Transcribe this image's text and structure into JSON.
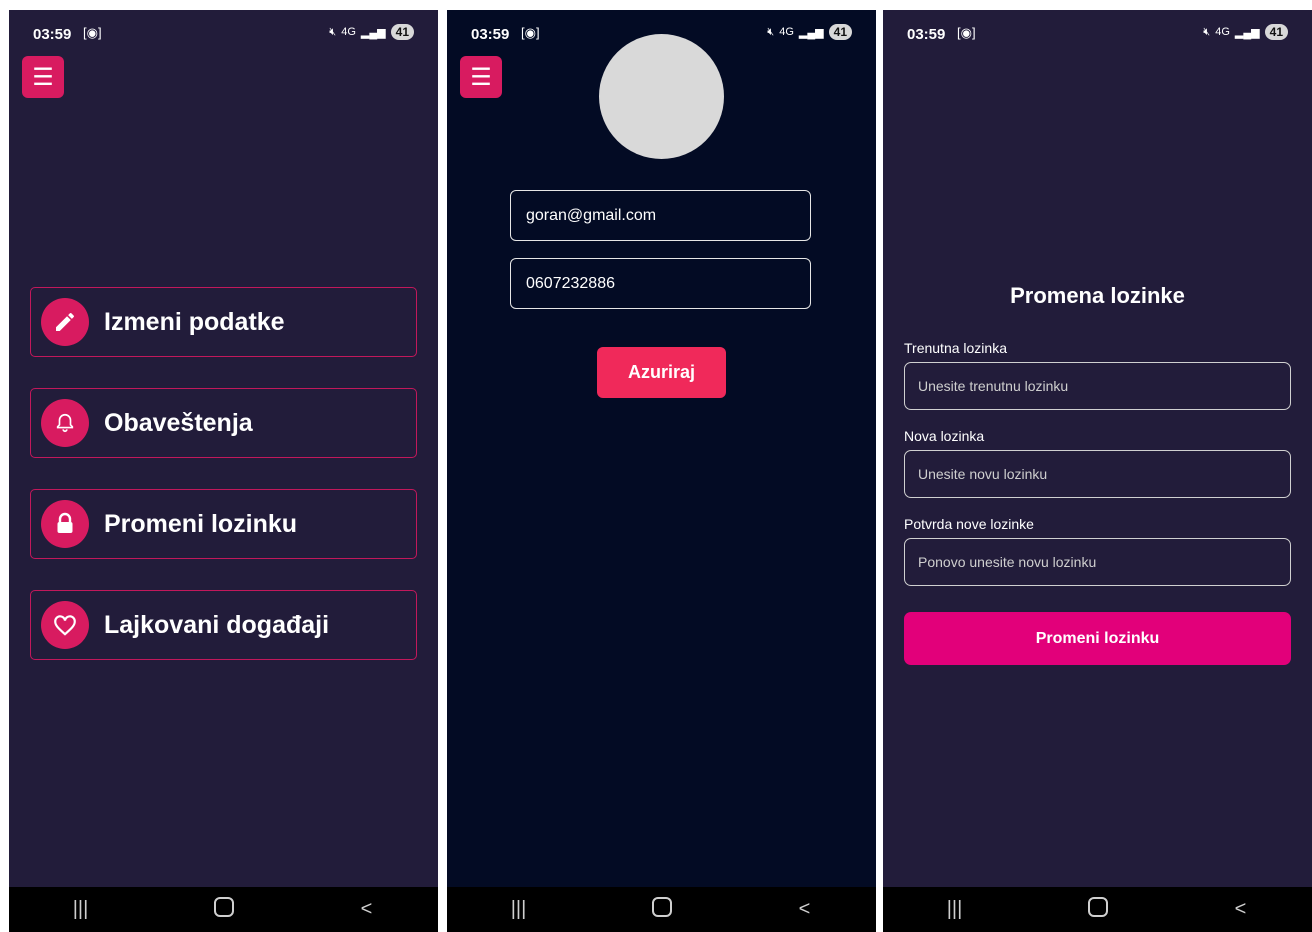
{
  "status_bar": {
    "time": "03:59",
    "signal_label": "4G",
    "battery": "41"
  },
  "nav_bar": {
    "recents_glyph": "|||",
    "back_glyph": "<"
  },
  "screen1": {
    "menu_items": [
      {
        "label": "Izmeni podatke",
        "icon": "pencil-icon"
      },
      {
        "label": "Obaveštenja",
        "icon": "bell-icon"
      },
      {
        "label": "Promeni lozinku",
        "icon": "lock-icon"
      },
      {
        "label": "Lajkovani događaji",
        "icon": "heart-icon"
      }
    ]
  },
  "screen2": {
    "email_value": "goran@gmail.com",
    "phone_value": "0607232886",
    "update_button": "Azuriraj"
  },
  "screen3": {
    "title": "Promena lozinke",
    "current_label": "Trenutna lozinka",
    "current_placeholder": "Unesite trenutnu lozinku",
    "new_label": "Nova lozinka",
    "new_placeholder": "Unesite novu lozinku",
    "confirm_label": "Potvrda nove lozinke",
    "confirm_placeholder": "Ponovo unesite novu lozinku",
    "submit_button": "Promeni lozinku"
  },
  "colors": {
    "accent": "#d81b60",
    "screen_bg": "#221c3a",
    "screen2_bg": "#030b24",
    "update_button": "#f0295a",
    "submit_button": "#e2007a"
  }
}
